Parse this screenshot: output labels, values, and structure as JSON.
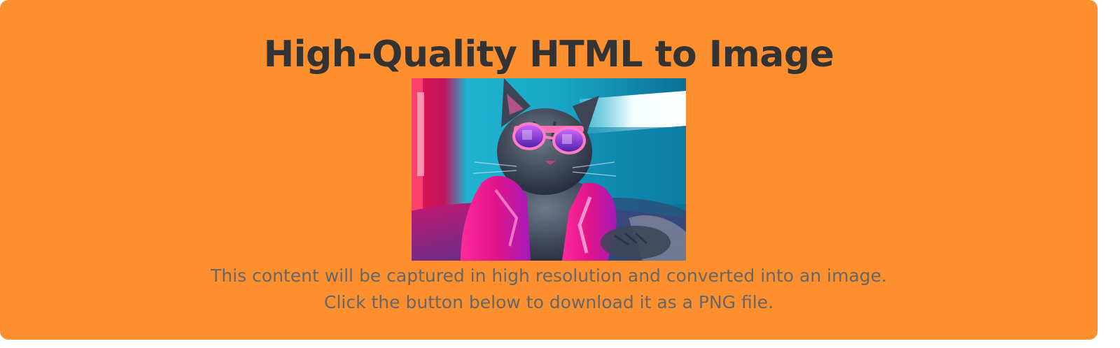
{
  "card": {
    "background_color": "#fe8f2f",
    "title": "High-Quality HTML to Image",
    "title_color": "#333333",
    "description_color": "#666666",
    "description_line_1": "This content will be captured in high resolution and converted into an image.",
    "description_line_2": "Click the button below to download it as a PNG file."
  },
  "image": {
    "subject": "cat-wearing-pink-sunglasses-and-pink-jacket-neon-lighting"
  }
}
